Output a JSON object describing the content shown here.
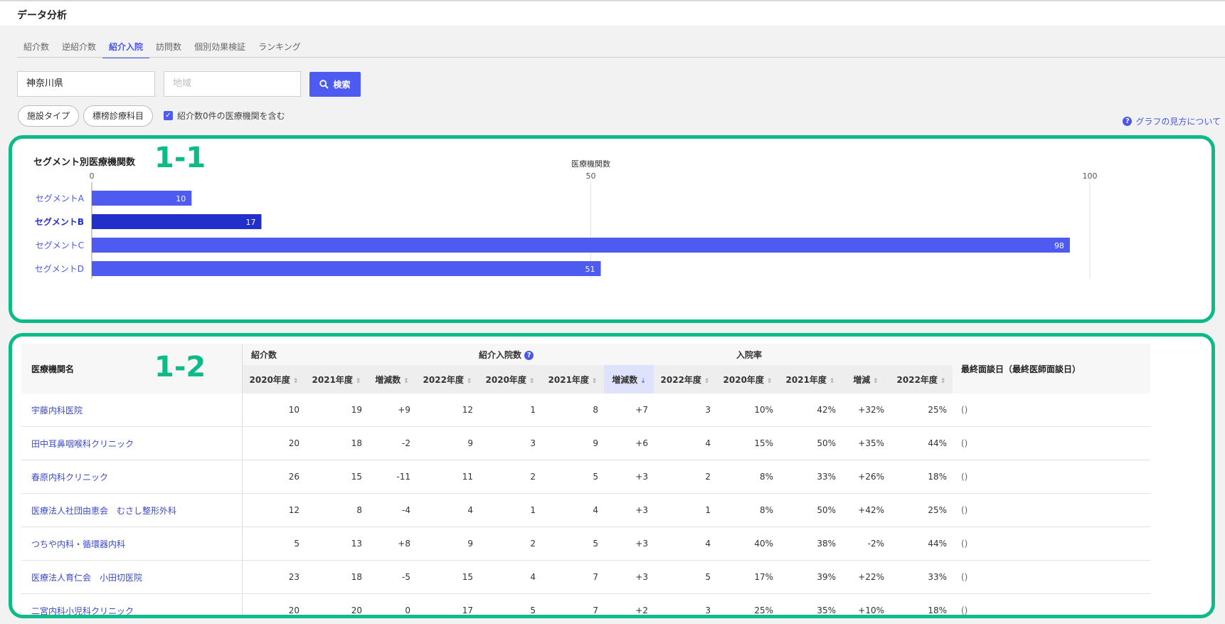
{
  "page_title": "データ分析",
  "tabs": [
    {
      "label": "紹介数",
      "active": false
    },
    {
      "label": "逆紹介数",
      "active": false
    },
    {
      "label": "紹介入院",
      "active": true
    },
    {
      "label": "訪問数",
      "active": false
    },
    {
      "label": "個別効果検証",
      "active": false
    },
    {
      "label": "ランキング",
      "active": false
    }
  ],
  "search": {
    "prefecture_value": "神奈川県",
    "region_placeholder": "地域",
    "button_label": "検索",
    "icon": "search-icon"
  },
  "filters": {
    "facility_type_label": "施設タイプ",
    "specialty_label": "標榜診療科目",
    "include_zero_label": "紹介数0件の医療機関を含む",
    "include_zero_checked": true
  },
  "help_link_label": "グラフの見方について",
  "annotations": {
    "section1": "1-1",
    "section2": "1-2"
  },
  "chart_data": {
    "type": "bar",
    "orientation": "horizontal",
    "title": "セグメント別医療機関数",
    "xlabel": "医療機関数",
    "xlim": [
      0,
      100
    ],
    "ticks": [
      0,
      50,
      100
    ],
    "categories": [
      "セグメントA",
      "セグメントB",
      "セグメントC",
      "セグメントD"
    ],
    "values": [
      10,
      17,
      98,
      51
    ],
    "colors": [
      "#4d5bf0",
      "#2130c8",
      "#4d5bf0",
      "#4d5bf0"
    ],
    "grid": true
  },
  "table": {
    "name_header": "医療機関名",
    "groups": [
      {
        "label": "紹介数"
      },
      {
        "label": "紹介入院数",
        "help_icon": true
      },
      {
        "label": "入院率"
      }
    ],
    "last_header": "最終面談日（最終医師面談日）",
    "sub_headers": [
      "2020年度",
      "2021年度",
      "増減数",
      "2022年度",
      "2020年度",
      "2021年度",
      "増減数",
      "2022年度",
      "2020年度",
      "2021年度",
      "増減",
      "2022年度"
    ],
    "sorted_column_index": 6,
    "rows": [
      {
        "name": "宇藤内科医院",
        "values": [
          "10",
          "19",
          "+9",
          "12",
          "1",
          "8",
          "+7",
          "3",
          "10%",
          "42%",
          "+32%",
          "25%"
        ],
        "last": "()"
      },
      {
        "name": "田中耳鼻咽喉科クリニック",
        "values": [
          "20",
          "18",
          "-2",
          "9",
          "3",
          "9",
          "+6",
          "4",
          "15%",
          "50%",
          "+35%",
          "44%"
        ],
        "last": "()"
      },
      {
        "name": "春原内科クリニック",
        "values": [
          "26",
          "15",
          "-11",
          "11",
          "2",
          "5",
          "+3",
          "2",
          "8%",
          "33%",
          "+26%",
          "18%"
        ],
        "last": "()"
      },
      {
        "name": "医療法人社団由恵会　むさし整形外科",
        "values": [
          "12",
          "8",
          "-4",
          "4",
          "1",
          "4",
          "+3",
          "1",
          "8%",
          "50%",
          "+42%",
          "25%"
        ],
        "last": "()"
      },
      {
        "name": "つちや内科・循環器内科",
        "values": [
          "5",
          "13",
          "+8",
          "9",
          "2",
          "5",
          "+3",
          "4",
          "40%",
          "38%",
          "-2%",
          "44%"
        ],
        "last": "()"
      },
      {
        "name": "医療法人育仁会　小田切医院",
        "values": [
          "23",
          "18",
          "-5",
          "15",
          "4",
          "7",
          "+3",
          "5",
          "17%",
          "39%",
          "+22%",
          "33%"
        ],
        "last": "()"
      },
      {
        "name": "二宮内科小児科クリニック",
        "values": [
          "20",
          "20",
          "0",
          "17",
          "5",
          "7",
          "+2",
          "3",
          "25%",
          "35%",
          "+10%",
          "18%"
        ],
        "last": "()"
      }
    ]
  }
}
